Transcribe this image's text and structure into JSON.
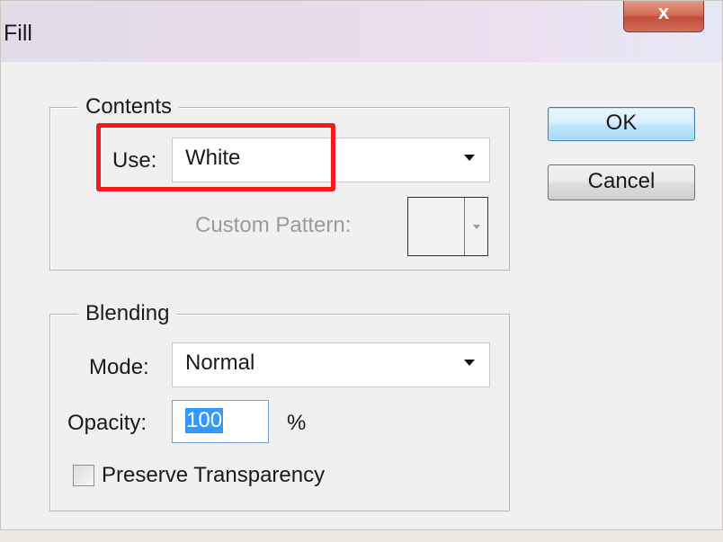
{
  "window": {
    "title": "Fill",
    "close_glyph": "x",
    "close_icon": "close-icon"
  },
  "contents": {
    "legend": "Contents",
    "use_label": "Use:",
    "use_value": "White",
    "custom_pattern_label": "Custom Pattern:"
  },
  "blending": {
    "legend": "Blending",
    "mode_label": "Mode:",
    "mode_value": "Normal",
    "opacity_label": "Opacity:",
    "opacity_value": "100",
    "opacity_unit": "%",
    "preserve_label": "Preserve Transparency"
  },
  "buttons": {
    "ok": "OK",
    "cancel": "Cancel"
  },
  "colors": {
    "highlight": "#ee1c1c",
    "selection": "#3399ff"
  }
}
